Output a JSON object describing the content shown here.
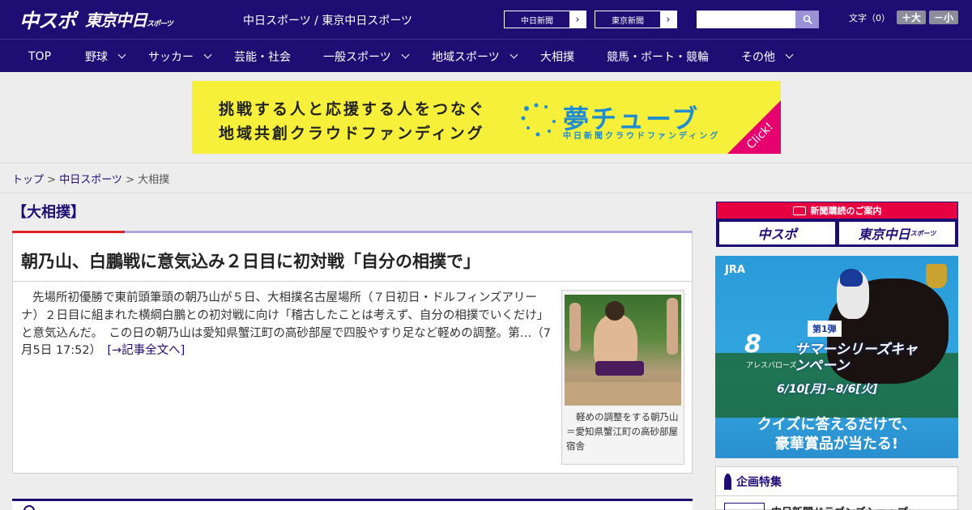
{
  "header": {
    "logo_main": "中スポ",
    "logo_tokyo": "東京中日",
    "logo_tokyo_small": "スポーツ",
    "site_title": "中日スポーツ / 東京中日スポーツ",
    "link_chunichi": "中日新聞",
    "link_tokyo": "東京新聞",
    "search_placeholder": "",
    "font_label": "文字（0）",
    "font_up": "＋大",
    "font_down": "－小"
  },
  "nav": [
    {
      "label": "TOP"
    },
    {
      "label": "野球"
    },
    {
      "label": "サッカー"
    },
    {
      "label": "芸能・社会"
    },
    {
      "label": "一般スポーツ"
    },
    {
      "label": "地域スポーツ"
    },
    {
      "label": "大相撲"
    },
    {
      "label": "競馬・ボート・競輪"
    },
    {
      "label": "その他"
    }
  ],
  "banner": {
    "line1": "挑戦する人と応援する人をつなぐ",
    "line2": "地域共創クラウドファンディング",
    "brand": "夢チューブ",
    "brand_sub": "中日新聞クラウドファンディング",
    "click": "Click!"
  },
  "breadcrumb": {
    "home": "トップ",
    "sep1": " > ",
    "section": "中日スポーツ",
    "sep2": " > ",
    "current": "大相撲"
  },
  "article": {
    "category": "【大相撲】",
    "headline": "朝乃山、白鵬戦に意気込み２日目に初対戦「自分の相撲で」",
    "body": "先場所初優勝で東前頭筆頭の朝乃山が５日、大相撲名古屋場所（７日初日・ドルフィンズアリーナ）２日目に組まれた横綱白鵬との初対戦に向け「稽古したことは考えず、自分の相撲でいくだけ」と意気込んだ。　この日の朝乃山は愛知県蟹江町の高砂部屋で四股やすり足など軽めの調整。第…（7月5日 17:52）",
    "more_link": "[→記事全文へ]",
    "caption": "軽めの調整をする朝乃山＝愛知県蟹江町の高砂部屋宿舎"
  },
  "sidebar": {
    "subscribe_label": "新聞購読のご案内",
    "sub_chuspo": "中スポ",
    "sub_tokyo": "東京中日",
    "sub_tokyo_small": "スポーツ",
    "jra_logo": "JRA",
    "jra_num": "8",
    "jra_num_sub": "アレスバローズ",
    "jra_badge": "第1弾",
    "jra_campaign": "サマーシリーズキャンペーン",
    "jra_dates": "6/10[月]~8/6[火]",
    "jra_q1": "クイズに答えるだけで、",
    "jra_q2": "豪華賞品が当たる!",
    "feature_title": "企画特集",
    "feature_item": "中日新聞ドラゴンズショップ"
  }
}
